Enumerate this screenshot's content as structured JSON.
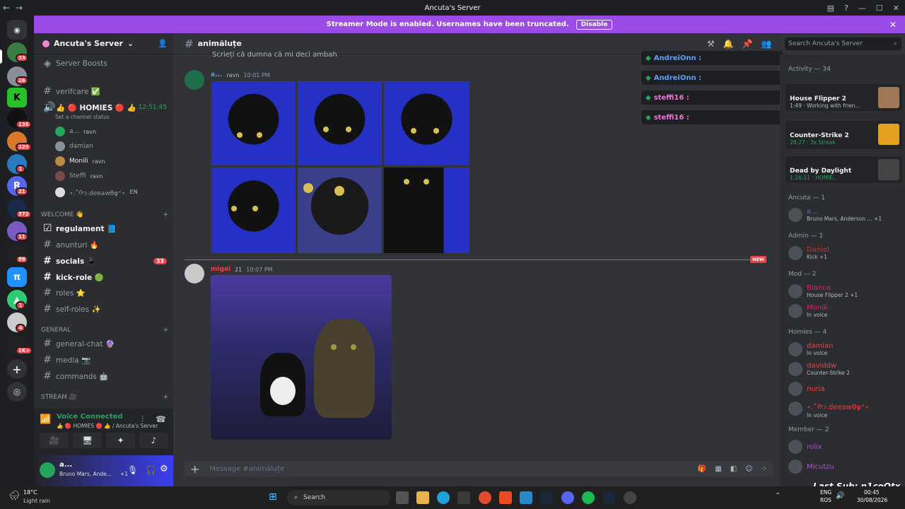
{
  "window": {
    "title": "Ancuta's Server"
  },
  "banner": {
    "text": "Streamer Mode is enabled. Usernames have been truncated.",
    "button": "Disable"
  },
  "guild_badges": [
    "33",
    "26",
    "136",
    "225",
    "1",
    "21",
    "372",
    "11",
    "99",
    "1",
    "4",
    "1K+"
  ],
  "server": {
    "name": "Ancuta's Server",
    "boosts": "Server Boosts"
  },
  "channels": {
    "verifcare": "verifcare ✅",
    "voice_name": "👍 🔴 HOMIES 🔴 👍",
    "voice_timer": "12:51:45",
    "voice_status": "Set a channel status",
    "voice_users": [
      {
        "name": "a...",
        "tag": "ravn"
      },
      {
        "name": "damian",
        "tag": ""
      },
      {
        "name": "Monili",
        "tag": "ravn"
      },
      {
        "name": "Steffi",
        "tag": "ravn"
      },
      {
        "name": "⋆.˚ᡣ𐭩.deeawθφ⁺⋆",
        "tag": "EN"
      }
    ],
    "cat_welcome": "WELCOME 👋",
    "regulament": "regulament 📘",
    "anunturi": "anunturi 🔥",
    "socials": "socials 📱",
    "socials_badge": "33",
    "kick_role": "kick-role 🟢",
    "roles": "roles ⭐",
    "self_roles": "self-roles ✨",
    "cat_general": "GENERAL",
    "general_chat": "general-chat 🔮",
    "media": "media 📷",
    "commands": "commands 🤖",
    "cat_stream": "STREAM 🎥"
  },
  "voice_panel": {
    "status": "Voice Connected",
    "location": "👍 🔴 HOMIES 🔴 👍 / Ancuta's Server",
    "user": "a...",
    "activity": "Bruno Mars, Ande...",
    "extra": "+1"
  },
  "chat": {
    "channel": "animăluțe",
    "prev_line": "Scrieți că dumna că mi deci ambah",
    "msg1": {
      "author": "a...",
      "tag": "ravn",
      "time": "10:01 PM"
    },
    "msg2": {
      "author": "migai",
      "tag": "21",
      "time": "10:07 PM"
    },
    "new_label": "NEW",
    "composer_placeholder": "Message #animăluțe"
  },
  "header_search": "Search Ancuta's Server",
  "voice_overlay": [
    {
      "name": "AndreiOnn :"
    },
    {
      "name": "AndreiOnn :"
    },
    {
      "name": "steffi16 :"
    },
    {
      "name": "steffi16 :"
    }
  ],
  "members": {
    "activity_header": "Activity — 34",
    "activities": [
      {
        "title": "House Flipper 2",
        "sub": "1:49 · Working with frien..."
      },
      {
        "title": "Counter-Strike 2",
        "sub": "28:27 · 3x Streak"
      },
      {
        "title": "Dead by Daylight",
        "sub": "1:26:21 · HOMIE..."
      }
    ],
    "groups": [
      {
        "label": "Ancuta — 1",
        "members": [
          {
            "name": "a...",
            "status": "Bruno Mars, Anderson ... +1",
            "color": "#5865f2"
          }
        ]
      },
      {
        "label": "Admin — 1",
        "members": [
          {
            "name": "Daniel",
            "status": "Kick +1",
            "color": "#c9302c"
          }
        ]
      },
      {
        "label": "Mod — 2",
        "members": [
          {
            "name": "Bianca",
            "status": "House Flipper 2 +1",
            "color": "#e91e63"
          },
          {
            "name": "Monili",
            "status": "In voice",
            "color": "#e91e63"
          }
        ]
      },
      {
        "label": "Homies — 4",
        "members": [
          {
            "name": "damian",
            "status": "In voice",
            "color": "#f23f43"
          },
          {
            "name": "daviddw",
            "status": "Counter-Strike 2",
            "color": "#f23f43"
          },
          {
            "name": "nuria",
            "status": "",
            "color": "#f23f43"
          },
          {
            "name": "⋆.˚ᡣ𐭩.deeawθφ⁺⋆",
            "status": "In voice",
            "color": "#f23f43"
          }
        ]
      },
      {
        "label": "Member — 2",
        "members": [
          {
            "name": "rolix",
            "status": "",
            "color": "#9b59b6"
          },
          {
            "name": "Micutzu",
            "status": "",
            "color": "#9b59b6"
          }
        ]
      }
    ]
  },
  "overlay_text": "Last Sub: n1coOtx",
  "taskbar": {
    "weather_temp": "18°C",
    "weather_desc": "Light rain",
    "search": "Search",
    "lang1": "ENG",
    "lang2": "ROS",
    "time": "00:45",
    "date": "30/08/2026"
  }
}
